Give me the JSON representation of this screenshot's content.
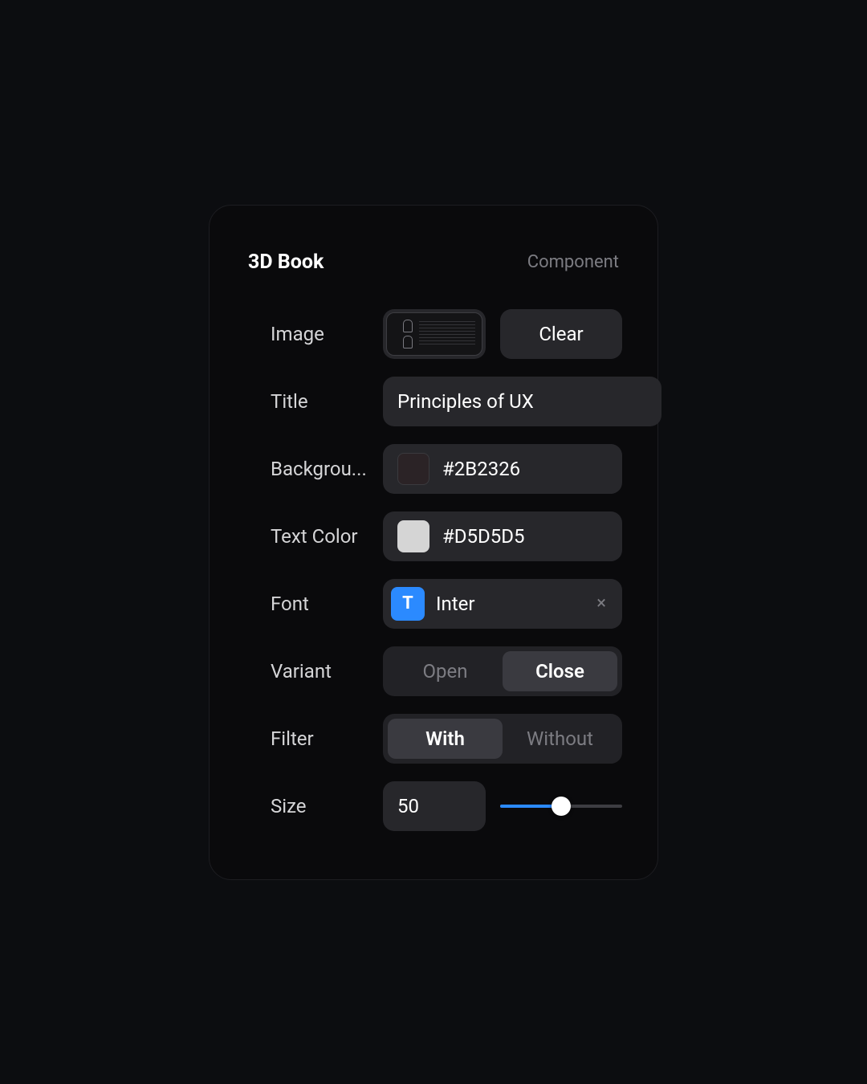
{
  "panel": {
    "title": "3D Book",
    "type_label": "Component"
  },
  "rows": {
    "image": {
      "label": "Image",
      "clear_label": "Clear"
    },
    "title": {
      "label": "Title",
      "value": "Principles of UX"
    },
    "background": {
      "label": "Backgrou...",
      "value": "#2B2326",
      "swatch": "#2B2326"
    },
    "textcolor": {
      "label": "Text Color",
      "value": "#D5D5D5",
      "swatch": "#D5D5D5"
    },
    "font": {
      "label": "Font",
      "icon_letter": "T",
      "name": "Inter",
      "clear_glyph": "×"
    },
    "variant": {
      "label": "Variant",
      "options": {
        "open": "Open",
        "close": "Close"
      },
      "active": "close"
    },
    "filter": {
      "label": "Filter",
      "options": {
        "with": "With",
        "without": "Without"
      },
      "active": "with"
    },
    "size": {
      "label": "Size",
      "value": "50",
      "percent": 50
    }
  },
  "colors": {
    "accent": "#2b8aff"
  }
}
